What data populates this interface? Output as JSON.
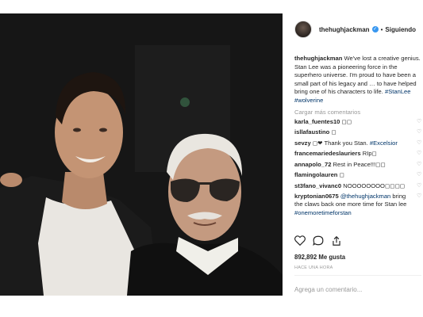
{
  "post": {
    "username": "thehughjackman",
    "follow_status": "Siguiendo",
    "verified": true,
    "caption_user": "thehughjackman",
    "caption_text": "We've lost a creative genius. Stan Lee was a pioneering force in the superhero universe. I'm proud to have been a small part of his legacy and … to have helped bring one of his characters to life. ",
    "caption_tags": [
      "#StanLee",
      "#wolverine"
    ]
  },
  "comments": {
    "load_more_label": "Cargar más comentarios",
    "items": [
      {
        "user": "karla_fuentes10",
        "text": "◻◻"
      },
      {
        "user": "isllafaustino",
        "text": "◻"
      },
      {
        "user": "sevzy",
        "text": "◻❤ Thank you Stan. ",
        "tag": "#Excelsior"
      },
      {
        "user": "francemariedeslauriers",
        "text": "RIp◻"
      },
      {
        "user": "annapolo_72",
        "text": "Rest in Peace!!!◻◻"
      },
      {
        "user": "flamingolauren",
        "text": "◻"
      },
      {
        "user": "st3fano_vivanc0",
        "text": "NOOOOOOOO◻◻◻◻"
      },
      {
        "user": "kryptonian0675",
        "mention": "@thehughjackman",
        "text": " bring the claws back one more time for Stan lee ",
        "tag": "#onemoretimeforstan"
      }
    ]
  },
  "actions": {
    "like_icon": "heart-icon",
    "comment_icon": "comment-icon",
    "share_icon": "share-icon"
  },
  "likes": "892,892 Me gusta",
  "time_ago": "HACE UNA HORA",
  "add_comment_placeholder": "Agrega un comentario..."
}
